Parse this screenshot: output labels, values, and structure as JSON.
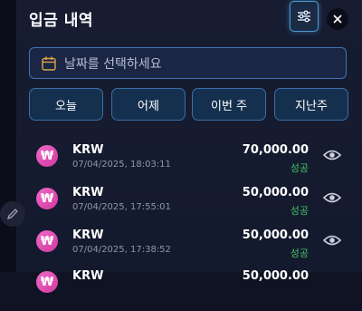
{
  "header": {
    "title": "입금 내역"
  },
  "icons": {
    "filter": "sliders-icon",
    "close": "close-icon",
    "calendar": "calendar-icon",
    "view": "eye-icon",
    "edit": "pencil-icon"
  },
  "date_picker": {
    "placeholder": "날짜를 선택하세요"
  },
  "quick_ranges": [
    "오늘",
    "어제",
    "이번 주",
    "지난주"
  ],
  "transactions": [
    {
      "currency": "KRW",
      "symbol": "₩",
      "datetime": "07/04/2025, 18:03:11",
      "amount": "70,000.00",
      "status": "성공"
    },
    {
      "currency": "KRW",
      "symbol": "₩",
      "datetime": "07/04/2025, 17:55:01",
      "amount": "50,000.00",
      "status": "성공"
    },
    {
      "currency": "KRW",
      "symbol": "₩",
      "datetime": "07/04/2025, 17:38:52",
      "amount": "50,000.00",
      "status": "성공"
    },
    {
      "currency": "KRW",
      "symbol": "₩",
      "datetime": "",
      "amount": "50,000.00",
      "status": ""
    }
  ],
  "colors": {
    "background": "#141a2d",
    "accent": "#3f73b6",
    "success": "#42c268",
    "coin": "#e04fb4"
  }
}
